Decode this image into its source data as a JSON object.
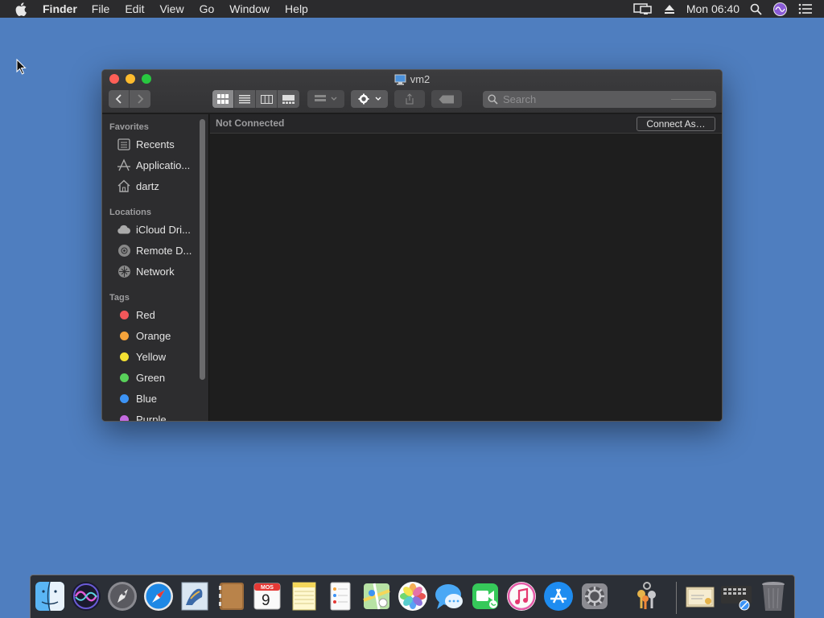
{
  "menubar": {
    "app_name": "Finder",
    "items": [
      "File",
      "Edit",
      "View",
      "Go",
      "Window",
      "Help"
    ],
    "clock": "Mon 06:40",
    "status_icons": [
      "display-icon",
      "eject-icon",
      "spotlight-icon",
      "siri-icon",
      "notification-center-icon"
    ]
  },
  "window": {
    "title": "vm2",
    "title_icon": "computer-icon",
    "search": {
      "placeholder": "Search"
    },
    "connection_status": "Not Connected",
    "connect_button": "Connect As…"
  },
  "sidebar": {
    "favorites_header": "Favorites",
    "favorites": [
      {
        "label": "Recents",
        "icon": "recents-icon"
      },
      {
        "label": "Applicatio...",
        "icon": "applications-icon"
      },
      {
        "label": "dartz",
        "icon": "home-icon"
      }
    ],
    "locations_header": "Locations",
    "locations": [
      {
        "label": "iCloud Dri...",
        "icon": "icloud-icon"
      },
      {
        "label": "Remote D...",
        "icon": "remote-disc-icon"
      },
      {
        "label": "Network",
        "icon": "network-icon"
      }
    ],
    "tags_header": "Tags",
    "tags": [
      {
        "label": "Red",
        "color": "#f2575a"
      },
      {
        "label": "Orange",
        "color": "#f5a33b"
      },
      {
        "label": "Yellow",
        "color": "#f4e132"
      },
      {
        "label": "Green",
        "color": "#58d15a"
      },
      {
        "label": "Blue",
        "color": "#3c93f5"
      },
      {
        "label": "Purple",
        "color": "#c46ae0"
      }
    ]
  },
  "dock": {
    "apps": [
      "finder-icon",
      "siri-icon",
      "launchpad-icon",
      "safari-icon",
      "mail-icon",
      "contacts-icon",
      "calendar-icon",
      "notes-icon",
      "reminders-icon",
      "maps-icon",
      "photos-icon",
      "messages-icon",
      "facetime-icon",
      "itunes-icon",
      "app-store-icon",
      "system-preferences-icon",
      "keychain-icon",
      "certificate-icon",
      "network-utility-icon",
      "trash-icon"
    ],
    "calendar": {
      "month": "MOS",
      "day": "9"
    }
  },
  "colors": {
    "desktop": "#4f7ebf",
    "window_bg": "#1e1e1e",
    "sidebar_bg": "#2d2d2f"
  }
}
